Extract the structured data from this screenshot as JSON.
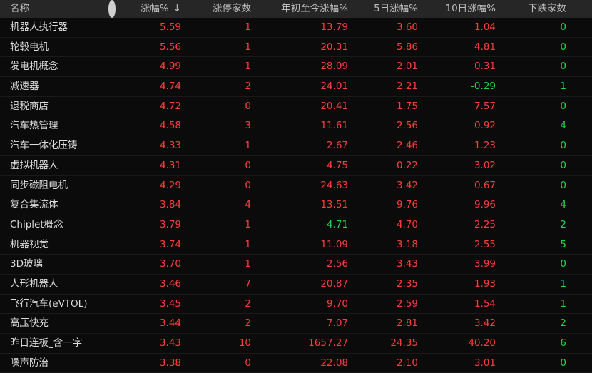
{
  "header": {
    "name": "名称",
    "change_pct": "涨幅%",
    "sort_arrow": "↓",
    "limit_up_count": "涨停家数",
    "ytd_change": "年初至今涨幅%",
    "d5_change": "5日涨幅%",
    "d10_change": "10日涨幅%",
    "down_count": "下跌家数"
  },
  "colors": {
    "up": "#ff3d3d",
    "down": "#1fd64a",
    "header_bg": "#262626",
    "bg": "#0b0b0b"
  },
  "rows": [
    {
      "name": "机器人执行器",
      "chg": "5.59",
      "lu": "1",
      "ytd": "13.79",
      "d5": "3.60",
      "d10": "1.04",
      "dn": "0"
    },
    {
      "name": "轮毂电机",
      "chg": "5.56",
      "lu": "1",
      "ytd": "20.31",
      "d5": "5.86",
      "d10": "4.81",
      "dn": "0"
    },
    {
      "name": "发电机概念",
      "chg": "4.99",
      "lu": "1",
      "ytd": "28.09",
      "d5": "2.01",
      "d10": "0.31",
      "dn": "0"
    },
    {
      "name": "减速器",
      "chg": "4.74",
      "lu": "2",
      "ytd": "24.01",
      "d5": "2.21",
      "d10": "-0.29",
      "dn": "1"
    },
    {
      "name": "退税商店",
      "chg": "4.72",
      "lu": "0",
      "ytd": "20.41",
      "d5": "1.75",
      "d10": "7.57",
      "dn": "0"
    },
    {
      "name": "汽车热管理",
      "chg": "4.58",
      "lu": "3",
      "ytd": "11.61",
      "d5": "2.56",
      "d10": "0.92",
      "dn": "4"
    },
    {
      "name": "汽车一体化压铸",
      "chg": "4.33",
      "lu": "1",
      "ytd": "2.67",
      "d5": "2.46",
      "d10": "1.23",
      "dn": "0"
    },
    {
      "name": "虚拟机器人",
      "chg": "4.31",
      "lu": "0",
      "ytd": "4.75",
      "d5": "0.22",
      "d10": "3.02",
      "dn": "0"
    },
    {
      "name": "同步磁阻电机",
      "chg": "4.29",
      "lu": "0",
      "ytd": "24.63",
      "d5": "3.42",
      "d10": "0.67",
      "dn": "0"
    },
    {
      "name": "复合集流体",
      "chg": "3.84",
      "lu": "4",
      "ytd": "13.51",
      "d5": "9.76",
      "d10": "9.96",
      "dn": "4"
    },
    {
      "name": "Chiplet概念",
      "chg": "3.79",
      "lu": "1",
      "ytd": "-4.71",
      "d5": "4.70",
      "d10": "2.25",
      "dn": "2"
    },
    {
      "name": "机器视觉",
      "chg": "3.74",
      "lu": "1",
      "ytd": "11.09",
      "d5": "3.18",
      "d10": "2.55",
      "dn": "5"
    },
    {
      "name": "3D玻璃",
      "chg": "3.70",
      "lu": "1",
      "ytd": "2.56",
      "d5": "3.43",
      "d10": "3.99",
      "dn": "0"
    },
    {
      "name": "人形机器人",
      "chg": "3.46",
      "lu": "7",
      "ytd": "20.87",
      "d5": "2.35",
      "d10": "1.93",
      "dn": "1"
    },
    {
      "name": "飞行汽车(eVTOL)",
      "chg": "3.45",
      "lu": "2",
      "ytd": "9.70",
      "d5": "2.59",
      "d10": "1.54",
      "dn": "1"
    },
    {
      "name": "高压快充",
      "chg": "3.44",
      "lu": "2",
      "ytd": "7.07",
      "d5": "2.81",
      "d10": "3.42",
      "dn": "2"
    },
    {
      "name": "昨日连板_含一字",
      "chg": "3.43",
      "lu": "10",
      "ytd": "1657.27",
      "d5": "24.35",
      "d10": "40.20",
      "dn": "6"
    },
    {
      "name": "噪声防治",
      "chg": "3.38",
      "lu": "0",
      "ytd": "22.08",
      "d5": "2.10",
      "d10": "3.01",
      "dn": "0"
    }
  ]
}
